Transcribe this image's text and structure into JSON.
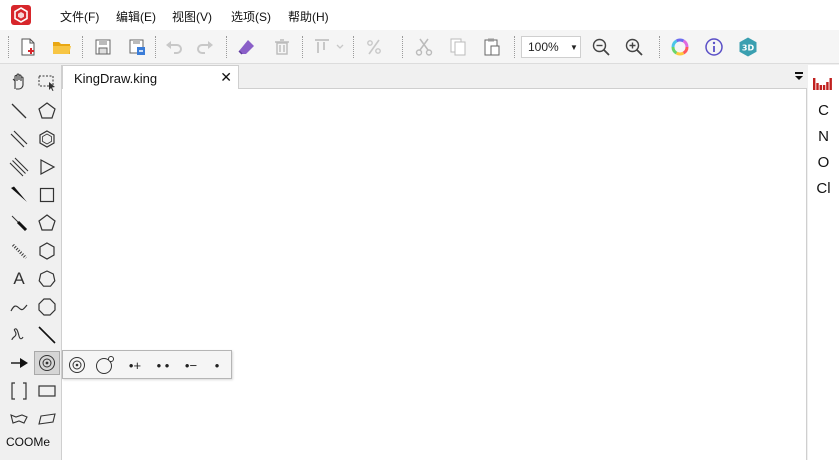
{
  "menu": {
    "items": [
      "文件(F)",
      "编辑(E)",
      "视图(V)",
      "选项(S)",
      "帮助(H)"
    ]
  },
  "toolbar": {
    "zoom_value": "100%"
  },
  "toolbox": {
    "text_tool_label": "A",
    "group_label": "COOMe"
  },
  "document": {
    "tab_title": "KingDraw.king",
    "close_glyph": "✕"
  },
  "element_panel": {
    "elements": [
      "C",
      "N",
      "O",
      "Cl"
    ]
  },
  "popup": {
    "items": [
      "•+",
      "• •",
      "•−",
      "•"
    ]
  },
  "colors": {
    "brand": "#d7262b",
    "folder": "#e9a713",
    "eraser": "#8a5fc8",
    "info": "#5a4fc7",
    "three_d": "#3a9fb0"
  },
  "icons": [
    "new-file-icon",
    "open-folder-icon",
    "save-icon",
    "save-as-icon",
    "undo-icon",
    "redo-icon",
    "eraser-icon",
    "delete-icon",
    "align-icon",
    "percent-icon",
    "cut-icon",
    "copy-icon",
    "paste-icon",
    "zoom-out-icon",
    "zoom-in-icon",
    "color-wheel-icon",
    "info-icon",
    "3d-icon"
  ]
}
